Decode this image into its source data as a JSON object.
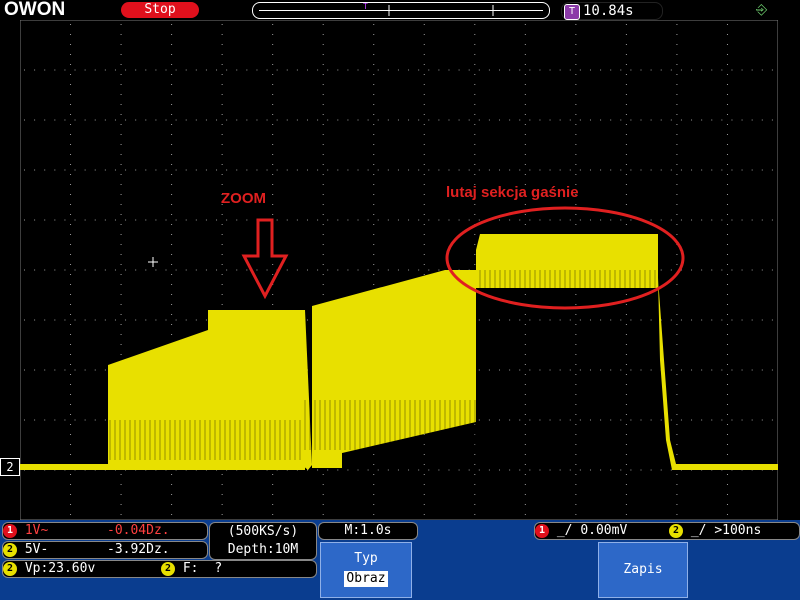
{
  "header": {
    "brand": "OWON",
    "status": "Stop",
    "timebase_icon": "T",
    "trigger_time": "10.84s",
    "usb_icon": "usb-icon"
  },
  "channels": {
    "ch1": {
      "num": "1",
      "scale": "1V~",
      "offset": "-0.04Dz."
    },
    "ch2": {
      "num": "2",
      "scale": "5V-",
      "offset": "-3.92Dz.",
      "marker": "2"
    }
  },
  "acquisition": {
    "rate": "(500KS/s)",
    "depth": "Depth:10M"
  },
  "measure": {
    "ch": "2",
    "vp": "Vp:23.60v",
    "ch_f": "2",
    "freq_label": "F:",
    "freq_value": "?"
  },
  "time_base": "M:1.0s",
  "trigger": {
    "ch1": "1",
    "level": "0.00mV",
    "ch2": "2",
    "time": ">100ns"
  },
  "menu": {
    "typ_label": "Typ",
    "obraz_label": "Obraz",
    "zapis_label": "Zapis"
  },
  "annotations": {
    "zoom": "ZOOM",
    "note": "lutaj sekcja gaśnie"
  },
  "colors": {
    "trace": "#e8e000",
    "annotation": "#e02020",
    "panel": "#0a3d8f"
  }
}
